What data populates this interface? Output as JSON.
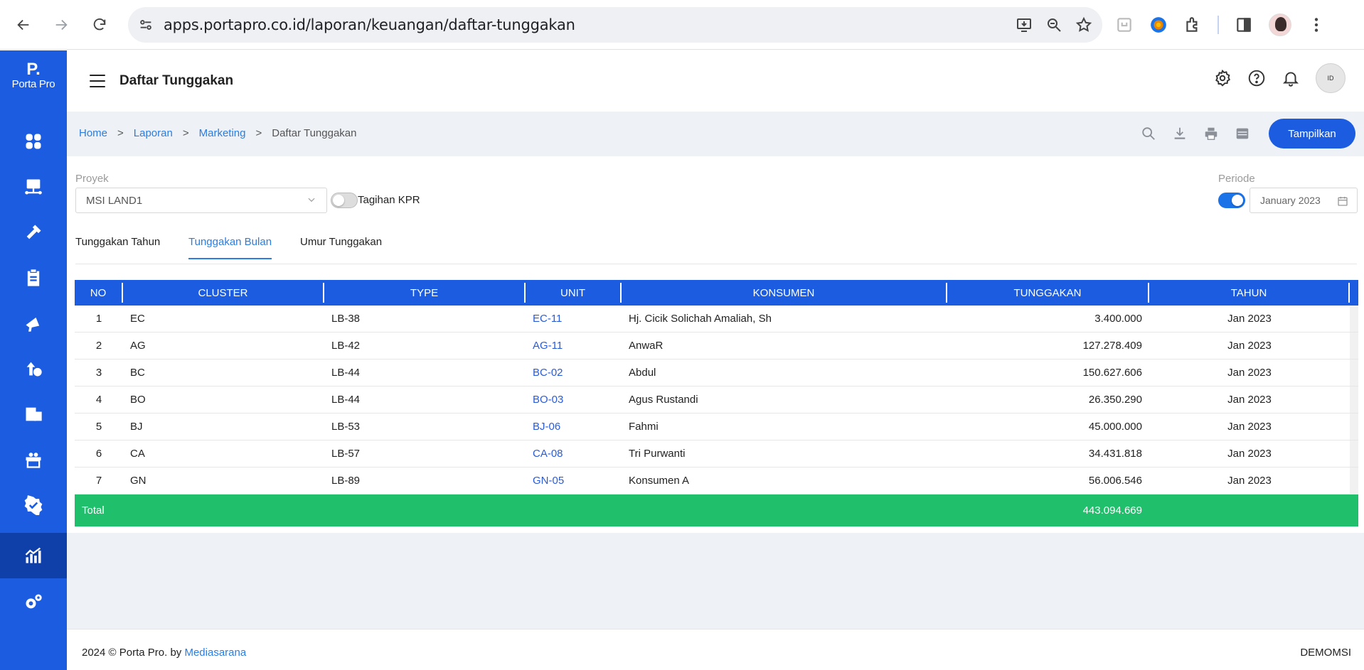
{
  "browser": {
    "url": "apps.portapro.co.id/laporan/keuangan/daftar-tunggakan"
  },
  "sidebar": {
    "logo_mark": "P.",
    "logo_text": "Porta Pro",
    "items": [
      {
        "icon": "dashboard-icon"
      },
      {
        "icon": "network-icon"
      },
      {
        "icon": "tools-icon"
      },
      {
        "icon": "clipboard-icon"
      },
      {
        "icon": "marketing-icon"
      },
      {
        "icon": "finance-icon"
      },
      {
        "icon": "billing-icon"
      },
      {
        "icon": "gift-icon"
      },
      {
        "icon": "verified-icon"
      },
      {
        "icon": "report-icon",
        "active": true
      },
      {
        "icon": "settings-icon"
      }
    ]
  },
  "header": {
    "title": "Daftar Tunggakan",
    "avatar_text": "ID"
  },
  "breadcrumb": {
    "home": "Home",
    "laporan": "Laporan",
    "marketing": "Marketing",
    "current": "Daftar Tunggakan",
    "sep": ">"
  },
  "toolbar": {
    "show_label": "Tampilkan"
  },
  "filters": {
    "proyek_label": "Proyek",
    "proyek_value": "MSI LAND1",
    "kpr_label": "Tagihan KPR",
    "kpr_on": false,
    "periode_label": "Periode",
    "periode_on": true,
    "periode_value": "January 2023"
  },
  "tabs": [
    {
      "label": "Tunggakan Tahun",
      "active": false
    },
    {
      "label": "Tunggakan Bulan",
      "active": true
    },
    {
      "label": "Umur Tunggakan",
      "active": false
    }
  ],
  "table": {
    "columns": [
      "NO",
      "CLUSTER",
      "TYPE",
      "UNIT",
      "KONSUMEN",
      "TUNGGAKAN",
      "TAHUN"
    ],
    "rows": [
      {
        "no": "1",
        "cluster": "EC",
        "type": "LB-38",
        "unit": "EC-11",
        "konsumen": "Hj. Cicik Solichah Amaliah, Sh",
        "tunggakan": "3.400.000",
        "tahun": "Jan 2023"
      },
      {
        "no": "2",
        "cluster": "AG",
        "type": "LB-42",
        "unit": "AG-11",
        "konsumen": "AnwaR",
        "tunggakan": "127.278.409",
        "tahun": "Jan 2023"
      },
      {
        "no": "3",
        "cluster": "BC",
        "type": "LB-44",
        "unit": "BC-02",
        "konsumen": "Abdul",
        "tunggakan": "150.627.606",
        "tahun": "Jan 2023"
      },
      {
        "no": "4",
        "cluster": "BO",
        "type": "LB-44",
        "unit": "BO-03",
        "konsumen": "Agus Rustandi",
        "tunggakan": "26.350.290",
        "tahun": "Jan 2023"
      },
      {
        "no": "5",
        "cluster": "BJ",
        "type": "LB-53",
        "unit": "BJ-06",
        "konsumen": "Fahmi",
        "tunggakan": "45.000.000",
        "tahun": "Jan 2023"
      },
      {
        "no": "6",
        "cluster": "CA",
        "type": "LB-57",
        "unit": "CA-08",
        "konsumen": "Tri Purwanti",
        "tunggakan": "34.431.818",
        "tahun": "Jan 2023"
      },
      {
        "no": "7",
        "cluster": "GN",
        "type": "LB-89",
        "unit": "GN-05",
        "konsumen": "Konsumen A",
        "tunggakan": "56.006.546",
        "tahun": "Jan 2023"
      }
    ],
    "total_label": "Total",
    "total_value": "443.094.669"
  },
  "footer": {
    "copyright": "2024 © Porta Pro. by ",
    "company_link": "Mediasarana",
    "tenant": "DEMOMSI"
  },
  "colors": {
    "primary": "#1b5ce0",
    "link": "#2a7de1",
    "total_bg": "#20bf6b"
  }
}
